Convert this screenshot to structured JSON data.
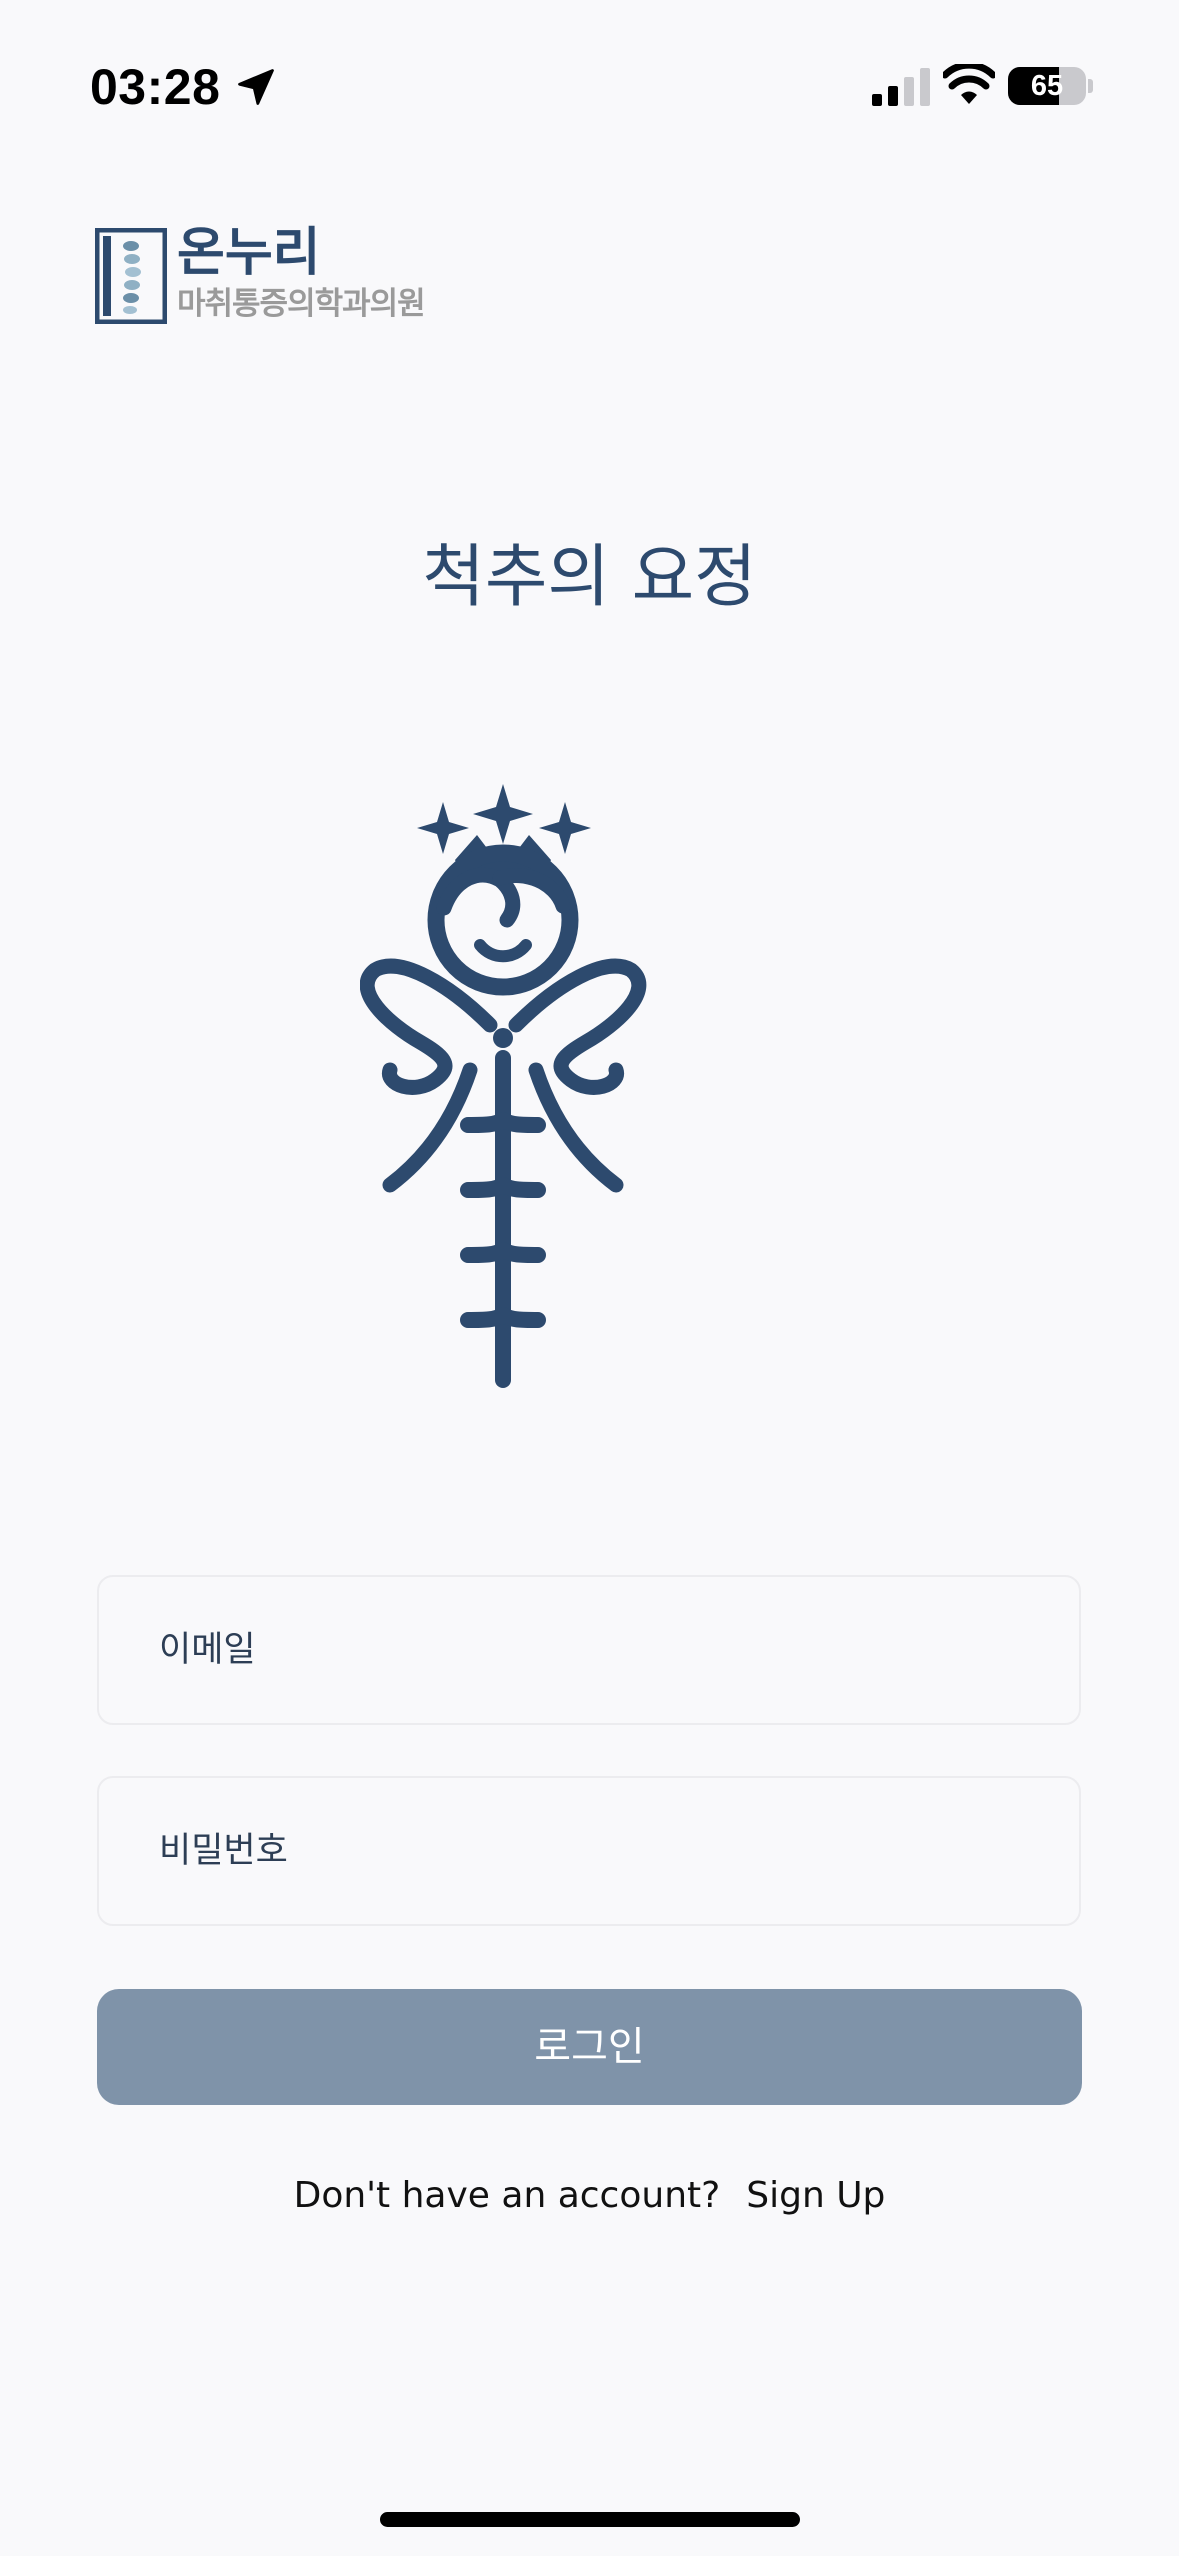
{
  "status_bar": {
    "time": "03:28",
    "battery_percent": "65",
    "battery_level": 0.65,
    "location_icon": "location-arrow-icon",
    "signal_icon": "cellular-signal-icon",
    "wifi_icon": "wifi-icon"
  },
  "clinic": {
    "name": "온누리",
    "subtitle": "마취통증의학과의원"
  },
  "app": {
    "title": "척추의 요정",
    "mascot_icon": "spine-fairy-mascot-icon"
  },
  "login_form": {
    "email_placeholder": "이메일",
    "password_placeholder": "비밀번호",
    "login_label": "로그인"
  },
  "signup": {
    "prompt": "Don't have an account?",
    "link_label": "Sign Up"
  },
  "colors": {
    "brand": "#2d4a6e",
    "button_disabled": "#7f93a9",
    "background": "#f9f9fb"
  }
}
